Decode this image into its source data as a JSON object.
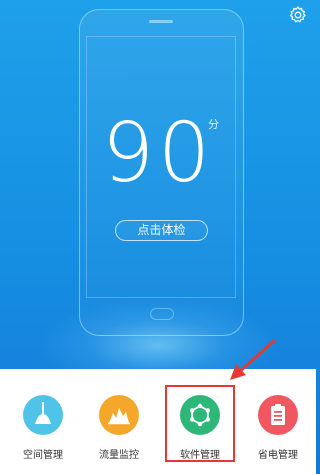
{
  "score": {
    "value": "90",
    "unit": "分"
  },
  "check_button": {
    "label": "点击体检"
  },
  "nav": {
    "items": [
      {
        "label": "空间管理",
        "icon": "broom-icon",
        "color": "#4fc3e8"
      },
      {
        "label": "流量监控",
        "icon": "traffic-chart-icon",
        "color": "#f4a72a"
      },
      {
        "label": "软件管理",
        "icon": "hexagon-apps-icon",
        "color": "#2db87a"
      },
      {
        "label": "省电管理",
        "icon": "battery-clipboard-icon",
        "color": "#f0575f"
      }
    ]
  },
  "colors": {
    "background": "#1890e4",
    "highlight": "#e53935"
  }
}
